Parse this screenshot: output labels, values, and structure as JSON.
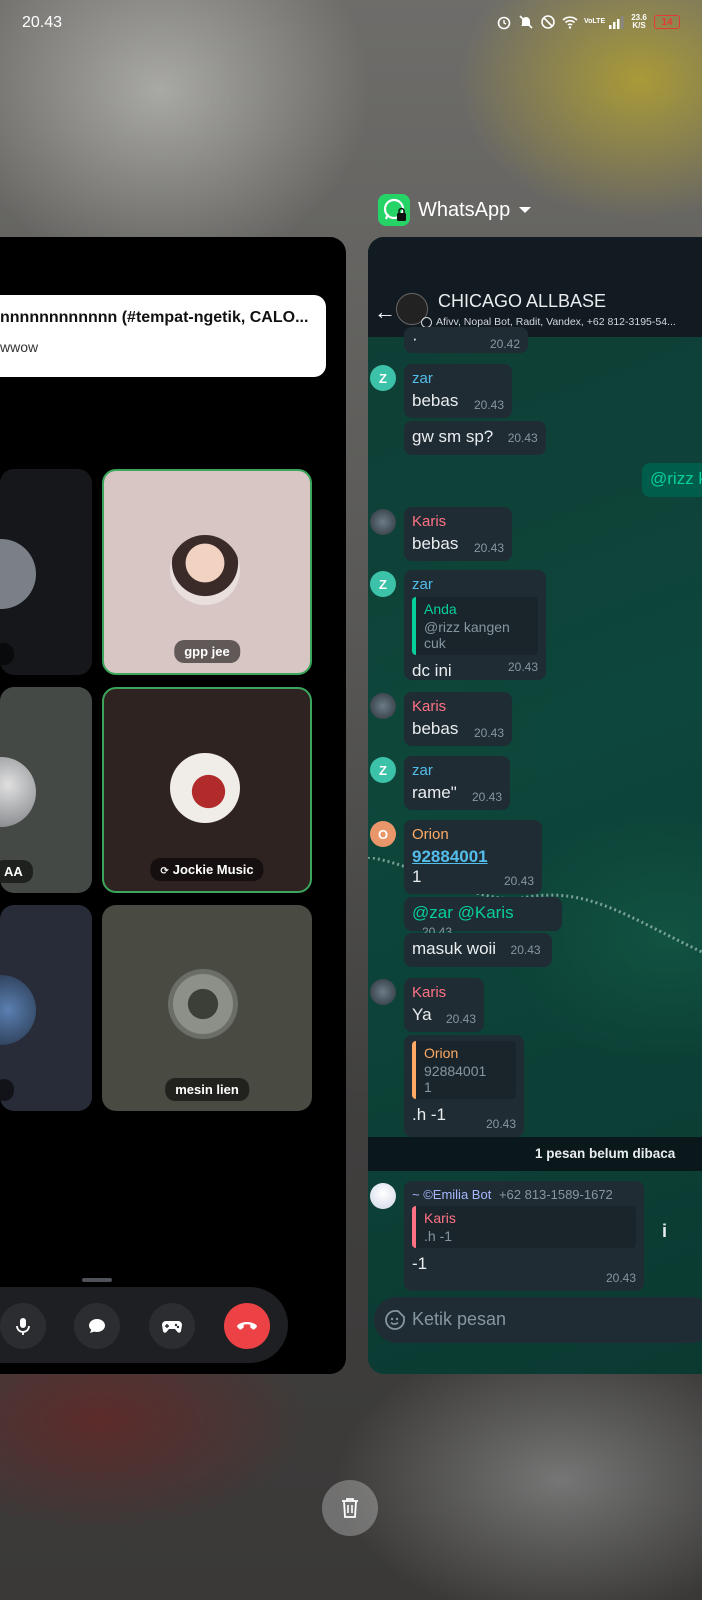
{
  "status_bar": {
    "time": "20.43",
    "network": "VoLTE",
    "net_speed": "23.6 K/S",
    "battery": "14"
  },
  "discord_card": {
    "notification": {
      "title": "nnnnnnnnnnnn (#tempat-ngetik, CALO...",
      "body": "wwow"
    },
    "participants": [
      {
        "name": ""
      },
      {
        "name": "gpp jee"
      },
      {
        "name": "AA"
      },
      {
        "name": "Jockie Music"
      },
      {
        "name": ""
      },
      {
        "name": "mesin lien"
      }
    ],
    "colors": {
      "speaking_border": "#3ba55c",
      "end_call": "#ed4245"
    }
  },
  "whatsapp_card": {
    "app_label": "WhatsApp",
    "chat": {
      "group_name": "CHICAGO ALLBASE",
      "members": "Afivv, Nopal Bot, Radit, Vandex, +62 812-3195-54..."
    },
    "messages": [
      {
        "sender": "",
        "text": "·",
        "time": "20.42"
      },
      {
        "sender": "zar",
        "text": "bebas",
        "time": "20.43"
      },
      {
        "sender": "",
        "text": "gw sm sp?",
        "time": "20.43"
      },
      {
        "sender": "me",
        "text": "@rizz k",
        "time": ""
      },
      {
        "sender": "Karis",
        "text": "bebas",
        "time": "20.43"
      },
      {
        "sender": "zar",
        "quote_name": "Anda",
        "quote_text": "@rizz kangen cuk",
        "text": "dc ini",
        "time": "20.43"
      },
      {
        "sender": "Karis",
        "text": "bebas",
        "time": "20.43"
      },
      {
        "sender": "zar",
        "text": "rame\"",
        "time": "20.43"
      },
      {
        "sender": "Orion",
        "link": "92884001",
        "text": "1",
        "time": "20.43"
      },
      {
        "sender": "",
        "mentions": "@zar @Karis",
        "time": "20.43"
      },
      {
        "sender": "",
        "text": "masuk woii",
        "time": "20.43"
      },
      {
        "sender": "Karis",
        "text": "Ya",
        "time": "20.43"
      },
      {
        "sender": "",
        "quote_name": "Orion",
        "quote_text": "92884001\n1",
        "text": ".h -1",
        "time": "20.43"
      }
    ],
    "unread_banner": "1 pesan belum dibaca",
    "last_message": {
      "sender": "~ ©Emilia Bot",
      "phone": "+62 813-1589-1672",
      "quote_name": "Karis",
      "quote_text": ".h -1",
      "text": "-1",
      "time": "20.43"
    },
    "info_button": "i",
    "input_placeholder": "Ketik pesan",
    "colors": {
      "zar": "#53bdeb",
      "karis": "#ff7285",
      "orion": "#ffaa64",
      "emilia": "#a5b7ff",
      "link": "#53bdeb",
      "mention": "#06cf9c"
    }
  }
}
